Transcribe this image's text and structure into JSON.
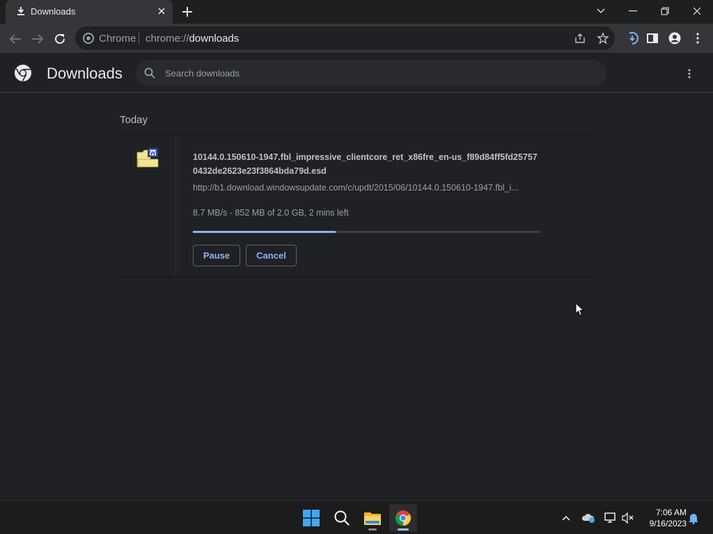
{
  "tab": {
    "title": "Downloads"
  },
  "omnibox": {
    "site_label": "Chrome",
    "url_prefix": "chrome://",
    "url_path": "downloads"
  },
  "page": {
    "title": "Downloads"
  },
  "search": {
    "placeholder": "Search downloads"
  },
  "downloads": {
    "date_group": "Today",
    "item": {
      "filename": "10144.0.150610-1947.fbl_impressive_clientcore_ret_x86fre_en-us_f89d84ff5fd257570432de2623e23f3864bda79d.esd",
      "url": "http://b1.download.windowsupdate.com/c/updt/2015/06/10144.0.150610-1947.fbl_i...",
      "status": "8.7 MB/s - 852 MB of 2.0 GB, 2 mins left",
      "progress_percent": 41,
      "pause_label": "Pause",
      "cancel_label": "Cancel"
    }
  },
  "taskbar": {
    "apps": [
      "start-icon",
      "search-icon",
      "file-explorer-icon",
      "chrome-icon"
    ],
    "time": "7:06 AM",
    "date": "9/16/2023"
  },
  "colors": {
    "accent": "#8ab4f8",
    "background": "#202124",
    "toolbar": "#35363a"
  }
}
